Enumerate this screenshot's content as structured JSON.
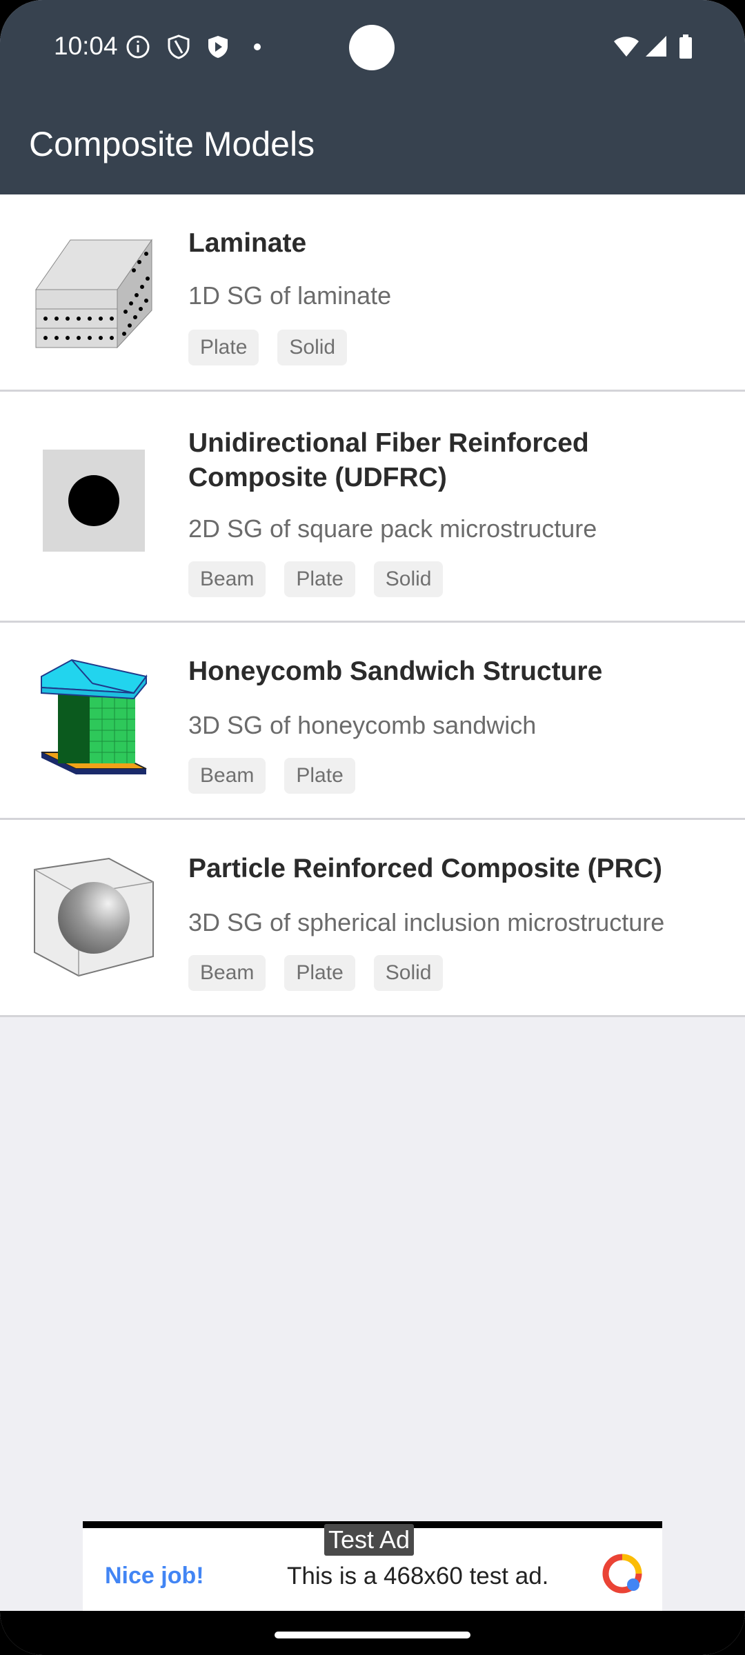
{
  "status_bar": {
    "time": "10:04",
    "icons": [
      "info-icon",
      "shield-outline-icon",
      "shield-play-icon",
      "dot-icon",
      "wifi-icon",
      "signal-icon",
      "battery-icon"
    ]
  },
  "app_bar": {
    "title": "Composite Models"
  },
  "colors": {
    "app_bar": "#37424f",
    "background": "#efeff3",
    "tag_bg": "#f0f0f0",
    "ad_link": "#4285f4"
  },
  "models": [
    {
      "title": "Laminate",
      "subtitle": "1D SG of laminate",
      "tags": [
        "Plate",
        "Solid"
      ],
      "icon": "laminate-icon"
    },
    {
      "title": "Unidirectional Fiber Reinforced Composite (UDFRC)",
      "subtitle": "2D SG of square pack microstructure",
      "tags": [
        "Beam",
        "Plate",
        "Solid"
      ],
      "icon": "fiber-icon"
    },
    {
      "title": "Honeycomb Sandwich Structure",
      "subtitle": "3D SG of honeycomb sandwich",
      "tags": [
        "Beam",
        "Plate"
      ],
      "icon": "honeycomb-icon"
    },
    {
      "title": "Particle Reinforced Composite (PRC)",
      "subtitle": "3D SG of spherical inclusion microstructure",
      "tags": [
        "Beam",
        "Plate",
        "Solid"
      ],
      "icon": "particle-icon"
    }
  ],
  "ad": {
    "label": "Test Ad",
    "cta": "Nice job!",
    "text": "This is a 468x60 test ad."
  }
}
